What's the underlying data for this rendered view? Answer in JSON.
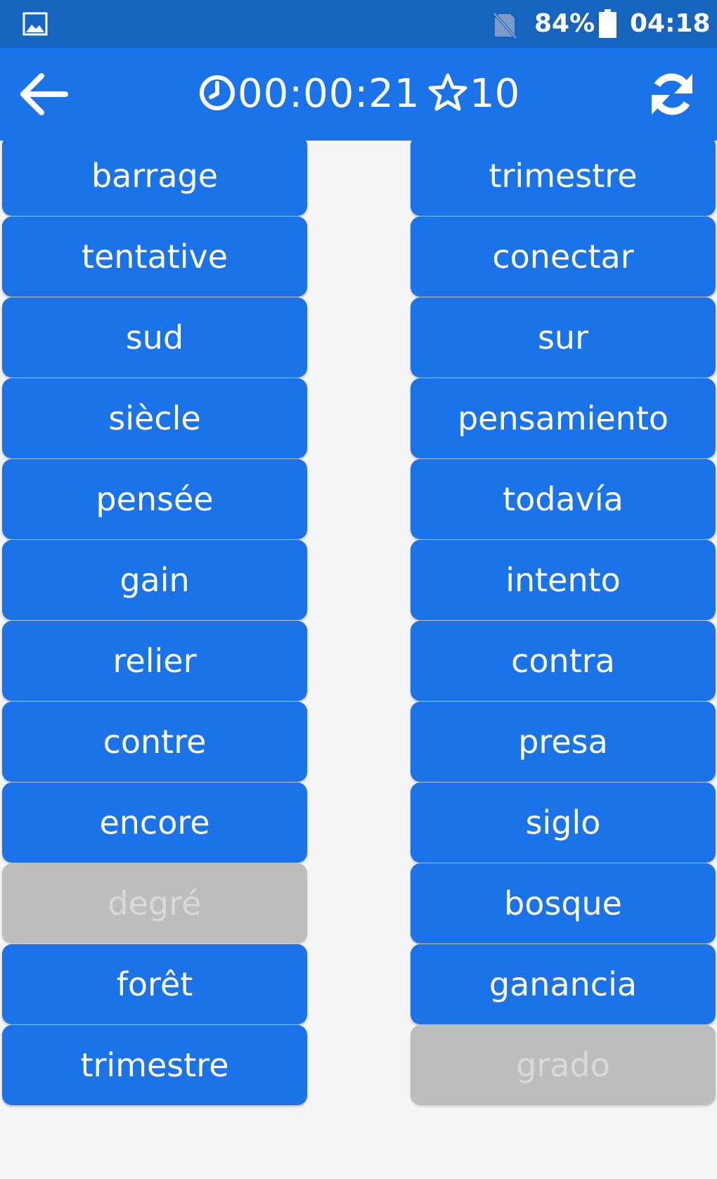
{
  "status_bar": {
    "battery_percent": "84%",
    "time": "04:18",
    "icons": [
      "gallery-icon",
      "no-sim-icon",
      "battery-icon"
    ]
  },
  "app_bar": {
    "timer": "00:00:21",
    "score": "10",
    "icons": [
      "back-arrow-icon",
      "clock-icon",
      "star-outline-icon",
      "refresh-icon"
    ]
  },
  "colors": {
    "status_bar": "#1565c0",
    "app_bar": "#1a73e8",
    "tile_active": "#1a73e8",
    "tile_matched": "#bdbdbd",
    "background": "#f5f5f5"
  },
  "left_words": [
    {
      "label": "barrage",
      "matched": false
    },
    {
      "label": "tentative",
      "matched": false
    },
    {
      "label": "sud",
      "matched": false
    },
    {
      "label": "siècle",
      "matched": false
    },
    {
      "label": "pensée",
      "matched": false
    },
    {
      "label": "gain",
      "matched": false
    },
    {
      "label": "relier",
      "matched": false
    },
    {
      "label": "contre",
      "matched": false
    },
    {
      "label": "encore",
      "matched": false
    },
    {
      "label": "degré",
      "matched": true
    },
    {
      "label": "forêt",
      "matched": false
    },
    {
      "label": "trimestre",
      "matched": false
    }
  ],
  "right_words": [
    {
      "label": "trimestre",
      "matched": false
    },
    {
      "label": "conectar",
      "matched": false
    },
    {
      "label": "sur",
      "matched": false
    },
    {
      "label": "pensamiento",
      "matched": false
    },
    {
      "label": "todavía",
      "matched": false
    },
    {
      "label": "intento",
      "matched": false
    },
    {
      "label": "contra",
      "matched": false
    },
    {
      "label": "presa",
      "matched": false
    },
    {
      "label": "siglo",
      "matched": false
    },
    {
      "label": "bosque",
      "matched": false
    },
    {
      "label": "ganancia",
      "matched": false
    },
    {
      "label": "grado",
      "matched": true
    }
  ]
}
